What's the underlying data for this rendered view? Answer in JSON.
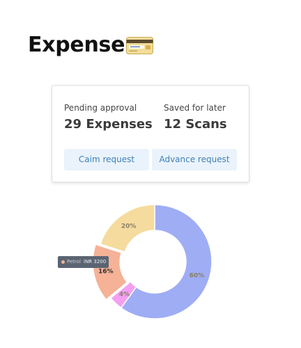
{
  "header": {
    "title": "Expense",
    "icon": "credit-card-icon"
  },
  "summary": {
    "pending": {
      "label": "Pending approval",
      "value": "29 Expenses"
    },
    "saved": {
      "label": "Saved for later",
      "value": "12 Scans"
    },
    "buttons": {
      "claim_label": "Caim request",
      "advance_label": "Advance request"
    }
  },
  "chart_data": {
    "type": "pie",
    "variant": "donut",
    "title": "",
    "slices": [
      {
        "label": "60%",
        "value": 60,
        "color": "#9fadf5"
      },
      {
        "label": "4%",
        "value": 4,
        "color": "#f4a0f2"
      },
      {
        "label": "16%",
        "value": 16,
        "color": "#f5b297"
      },
      {
        "label": "20%",
        "value": 20,
        "color": "#f6db9e"
      }
    ],
    "highlighted_slice": 2,
    "tooltip": {
      "name": "Petrol",
      "value": "INR 3200",
      "color": "#f5b297"
    }
  },
  "colors": {
    "button_bg": "#eaf3fb",
    "button_text": "#3f80b8",
    "tooltip_bg": "#5b6472"
  }
}
